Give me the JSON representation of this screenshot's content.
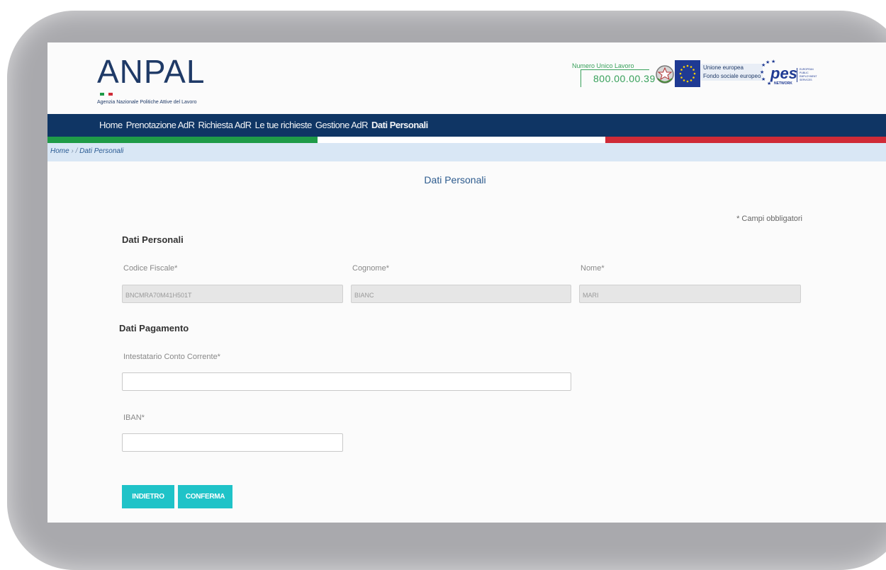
{
  "header": {
    "logo_text": "ANPAL",
    "logo_subtitle": "Agenzia Nazionale Politiche Attive del Lavoro",
    "numero_label": "Numero Unico Lavoro",
    "numero_value": "800.00.00.39",
    "eu_line1": "Unione europea",
    "eu_line2": "Fondo sociale europeo",
    "pes_text": "pes",
    "pes_network": "NETWORK"
  },
  "nav": {
    "items": [
      "Home",
      "Prenotazione AdR",
      "Richiesta AdR",
      "Le tue richieste",
      "Gestione AdR",
      "Dati Personali"
    ],
    "active_index": 5
  },
  "breadcrumb": {
    "home": "Home",
    "sep": "›  /",
    "current": "Dati Personali"
  },
  "page": {
    "title": "Dati Personali",
    "required_note": "* Campi obbligatori"
  },
  "dati_personali": {
    "section_title": "Dati Personali",
    "codice_fiscale_label": "Codice Fiscale*",
    "codice_fiscale_value": "BNCMRA70M41H501T",
    "cognome_label": "Cognome*",
    "cognome_value": "BIANC",
    "nome_label": "Nome*",
    "nome_value": "MARI"
  },
  "dati_pagamento": {
    "section_title": "Dati Pagamento",
    "intestatario_label": "Intestatario Conto Corrente*",
    "intestatario_value": "",
    "iban_label": "IBAN*",
    "iban_value": ""
  },
  "buttons": {
    "back_label": "INDIETRO",
    "confirm_label": "CONFERMA"
  },
  "colors": {
    "nav_bg": "#0f3564",
    "accent_button": "#1fc3c8",
    "breadcrumb_bg": "#d9e7f5",
    "flag_green": "#1f9b48",
    "flag_red": "#cf2b37"
  }
}
